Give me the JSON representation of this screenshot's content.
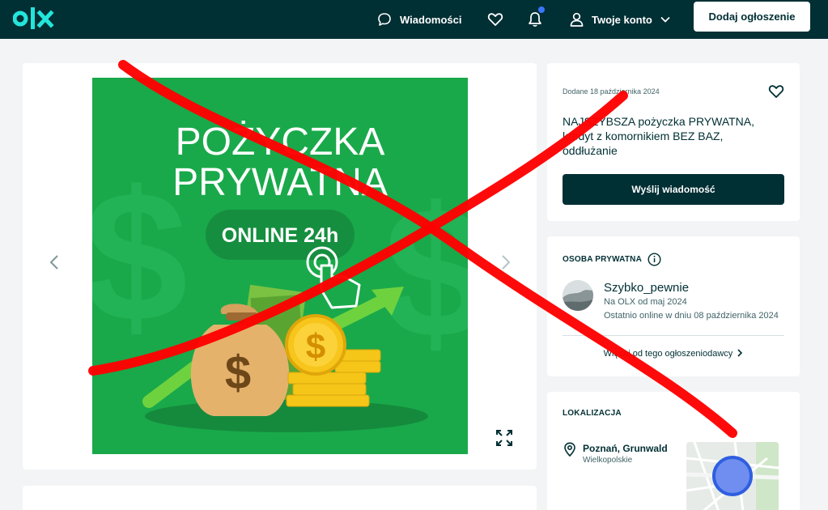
{
  "header": {
    "logo_text": "olx",
    "messages_label": "Wiadomości",
    "account_label": "Twoje konto",
    "add_button": "Dodaj ogłoszenie"
  },
  "gallery": {
    "banner": {
      "line1": "POŻYCZKA",
      "line2": "PRYWATNA",
      "pill": "ONLINE 24h",
      "bag_symbol": "$",
      "coin_symbol": "$"
    }
  },
  "ad": {
    "added": "Dodane 18 października 2024",
    "title_line1": "NAJSZYBSZA pożyczka PRYWATNA,",
    "title_line2": "kredyt z komornikiem BEZ BAZ,",
    "title_line3": "oddłużanie",
    "send_message": "Wyślij wiadomość"
  },
  "seller": {
    "heading": "OSOBA PRYWATNA",
    "name": "Szybko_pewnie",
    "since": "Na OLX od maj 2024",
    "last_online": "Ostatnio online w dniu 08 października 2024",
    "more_link": "Więcej od tego ogłoszeniodawcy"
  },
  "location": {
    "heading": "LOKALIZACJA",
    "city": "Poznań, Grunwald",
    "region": "Wielkopolskie"
  },
  "colors": {
    "header_bg": "#002f34",
    "logo_accent": "#23e5db",
    "banner_green": "#19a94a",
    "cross_red": "#ff0000"
  },
  "icons": [
    "chat-icon",
    "heart-icon",
    "bell-icon",
    "user-icon",
    "chevron-down-icon",
    "chevron-left-icon",
    "chevron-right-icon",
    "expand-icon",
    "info-icon",
    "pin-icon"
  ]
}
